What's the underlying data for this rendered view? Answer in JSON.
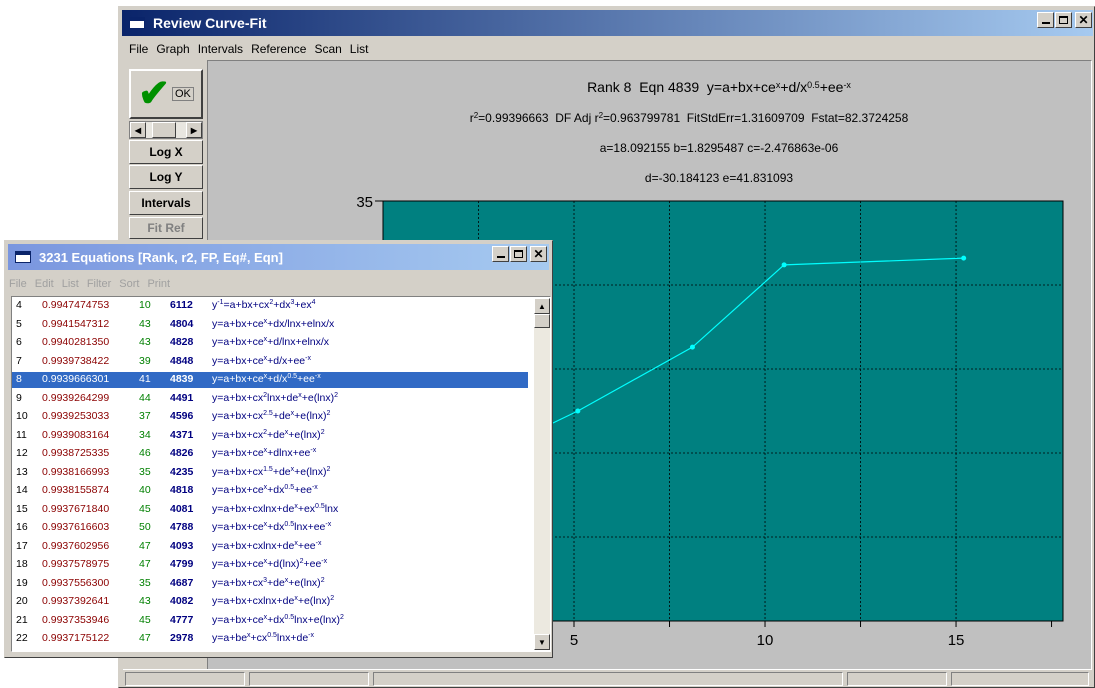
{
  "main_window": {
    "title": "Review Curve-Fit",
    "menu": [
      "File",
      "Graph",
      "Intervals",
      "Reference",
      "Scan",
      "List"
    ]
  },
  "toolbar": {
    "ok_label": "OK",
    "log_x": "Log X",
    "log_y": "Log Y",
    "intervals": "Intervals",
    "fit_ref": "Fit Ref"
  },
  "chart_header": {
    "line1": "Rank 8  Eqn 4839  y=a+bx+ce^x+d/x^0.5+ee^-x",
    "line2": "r²=0.99396663  DF Adj r²=0.963799781  FitStdErr=1.31609709  Fstat=82.3724258",
    "line3": "a=18.092155  b=1.8295487  c=-2.476863e-06",
    "line4": "d=-30.184123  e=41.831093"
  },
  "chart_data": {
    "type": "line",
    "plot_background": "#008080",
    "grid": true,
    "x_ticks": [
      "5",
      "10",
      "15"
    ],
    "y_ticks_visible": [
      "35"
    ],
    "data_points": [
      {
        "x": 5.1,
        "y": 22.5
      },
      {
        "x": 8.1,
        "y": 26.3
      },
      {
        "x": 10.5,
        "y": 31.2
      },
      {
        "x": 15.2,
        "y": 31.6
      }
    ],
    "data_color": "#00ffff",
    "curve_color": "#ffffff"
  },
  "eq_window": {
    "title": "3231 Equations  [Rank, r2, FP, Eq#, Eqn]",
    "menu": [
      "File",
      "Edit",
      "List",
      "Filter",
      "Sort",
      "Print"
    ],
    "rows": [
      {
        "rank": "4",
        "r2": "0.9947474753",
        "fp": "10",
        "eq": "6112",
        "eqn": "y<sup>-1</sup>=a+bx+cx<sup>2</sup>+dx<sup>3</sup>+ex<sup>4</sup>"
      },
      {
        "rank": "5",
        "r2": "0.9941547312",
        "fp": "43",
        "eq": "4804",
        "eqn": "y=a+bx+ce<sup>x</sup>+dx/lnx+elnx/x"
      },
      {
        "rank": "6",
        "r2": "0.9940281350",
        "fp": "43",
        "eq": "4828",
        "eqn": "y=a+bx+ce<sup>x</sup>+d/lnx+elnx/x"
      },
      {
        "rank": "7",
        "r2": "0.9939738422",
        "fp": "39",
        "eq": "4848",
        "eqn": "y=a+bx+ce<sup>x</sup>+d/x+ee<sup>-x</sup>"
      },
      {
        "rank": "8",
        "r2": "0.9939666301",
        "fp": "41",
        "eq": "4839",
        "eqn": "y=a+bx+ce<sup>x</sup>+d/x<sup>0.5</sup>+ee<sup>-x</sup>"
      },
      {
        "rank": "9",
        "r2": "0.9939264299",
        "fp": "44",
        "eq": "4491",
        "eqn": "y=a+bx+cx<sup>2</sup>lnx+de<sup>x</sup>+e(lnx)<sup>2</sup>"
      },
      {
        "rank": "10",
        "r2": "0.9939253033",
        "fp": "37",
        "eq": "4596",
        "eqn": "y=a+bx+cx<sup>2.5</sup>+de<sup>x</sup>+e(lnx)<sup>2</sup>"
      },
      {
        "rank": "11",
        "r2": "0.9939083164",
        "fp": "34",
        "eq": "4371",
        "eqn": "y=a+bx+cx<sup>2</sup>+de<sup>x</sup>+e(lnx)<sup>2</sup>"
      },
      {
        "rank": "12",
        "r2": "0.9938725335",
        "fp": "46",
        "eq": "4826",
        "eqn": "y=a+bx+ce<sup>x</sup>+dlnx+ee<sup>-x</sup>"
      },
      {
        "rank": "13",
        "r2": "0.9938166993",
        "fp": "35",
        "eq": "4235",
        "eqn": "y=a+bx+cx<sup>1.5</sup>+de<sup>x</sup>+e(lnx)<sup>2</sup>"
      },
      {
        "rank": "14",
        "r2": "0.9938155874",
        "fp": "40",
        "eq": "4818",
        "eqn": "y=a+bx+ce<sup>x</sup>+dx<sup>0.5</sup>+ee<sup>-x</sup>"
      },
      {
        "rank": "15",
        "r2": "0.9937671840",
        "fp": "45",
        "eq": "4081",
        "eqn": "y=a+bx+cxlnx+de<sup>x</sup>+ex<sup>0.5</sup>lnx"
      },
      {
        "rank": "16",
        "r2": "0.9937616603",
        "fp": "50",
        "eq": "4788",
        "eqn": "y=a+bx+ce<sup>x</sup>+dx<sup>0.5</sup>lnx+ee<sup>-x</sup>"
      },
      {
        "rank": "17",
        "r2": "0.9937602956",
        "fp": "47",
        "eq": "4093",
        "eqn": "y=a+bx+cxlnx+de<sup>x</sup>+ee<sup>-x</sup>"
      },
      {
        "rank": "18",
        "r2": "0.9937578975",
        "fp": "47",
        "eq": "4799",
        "eqn": "y=a+bx+ce<sup>x</sup>+d(lnx)<sup>2</sup>+ee<sup>-x</sup>"
      },
      {
        "rank": "19",
        "r2": "0.9937556300",
        "fp": "35",
        "eq": "4687",
        "eqn": "y=a+bx+cx<sup>3</sup>+de<sup>x</sup>+e(lnx)<sup>2</sup>"
      },
      {
        "rank": "20",
        "r2": "0.9937392641",
        "fp": "43",
        "eq": "4082",
        "eqn": "y=a+bx+cxlnx+de<sup>x</sup>+e(lnx)<sup>2</sup>"
      },
      {
        "rank": "21",
        "r2": "0.9937353946",
        "fp": "45",
        "eq": "4777",
        "eqn": "y=a+bx+ce<sup>x</sup>+dx<sup>0.5</sup>lnx+e(lnx)<sup>2</sup>"
      },
      {
        "rank": "22",
        "r2": "0.9937175122",
        "fp": "47",
        "eq": "2978",
        "eqn": "y=a+be<sup>x</sup>+cx<sup>0.5</sup>lnx+de<sup>-x</sup>"
      }
    ],
    "selected_rank": "8"
  },
  "colors": {
    "title_active": "#0a246a",
    "title_inactive": "#a6caf0",
    "selection": "#316ac5"
  }
}
